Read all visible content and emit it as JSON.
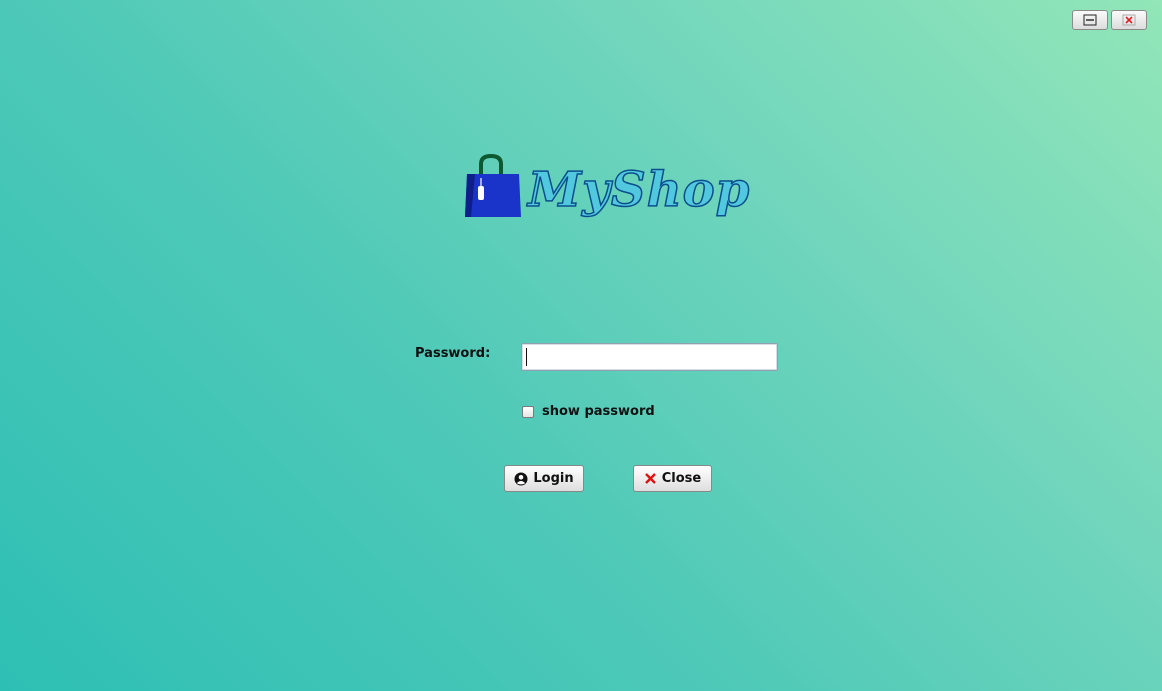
{
  "window_controls": {
    "minimize_icon": "minimize-icon",
    "close_icon": "close-x-icon",
    "close_color": "#e02020"
  },
  "logo": {
    "text": "MyShop",
    "bag_color": "#1a33c9",
    "handle_color": "#0d5a32"
  },
  "form": {
    "password_label": "Password:",
    "password_value": "",
    "show_password_label": "show password",
    "show_password_checked": false
  },
  "buttons": {
    "login_label": "Login",
    "login_icon": "user-circle-icon",
    "close_label": "Close",
    "close_icon": "red-x-icon",
    "close_icon_color": "#e01010"
  },
  "colors": {
    "bg_top_right": "#92e6b8",
    "bg_bottom_left": "#2ebfb4"
  }
}
